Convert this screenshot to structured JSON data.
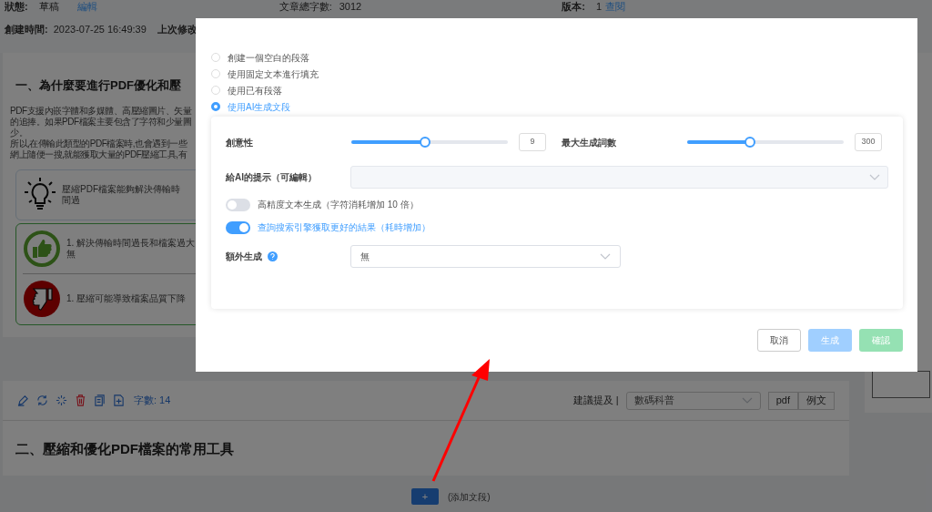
{
  "header": {
    "status_label": "狀態:",
    "status_value": "草稿",
    "edit_link": "編輯",
    "word_total_label": "文章總字數:",
    "word_total_value": "3012",
    "version_label": "版本:",
    "version_value": "1",
    "version_link": "查閱",
    "created_label": "創建時間:",
    "created_value": "2023-07-25 16:49:39",
    "modified_label": "上次修改"
  },
  "section_one": {
    "heading": "一、為什麼要進行PDF優化和壓",
    "paragraph_lines": [
      "PDF支援內嵌字體和多媒體、高壓縮圖片、矢量",
      "的追捧。如果PDF檔案主要包含了字符和少量圖",
      "少。",
      "所以,在傳輸此類型的PDF檔案時,也會遇到一些",
      "網上隨便一搜,就能獲取大量的PDF壓縮工具,有"
    ],
    "callout": "壓縮PDF檔案能夠解決傳輸時間過",
    "pros": [
      "1. 解決傳輸時間過長和檔案過大無"
    ],
    "cons": [
      "1. 壓縮可能導致檔案品質下降"
    ]
  },
  "section_two": {
    "word_count": "字數: 14",
    "suggest_label": "建議提及 |",
    "suggest_select": "數碼科普",
    "buttons": [
      "pdf",
      "例文"
    ],
    "heading": "二、壓縮和優化PDF檔案的常用工具"
  },
  "add_button": "+",
  "add_hint": "(添加文段)",
  "dialog": {
    "options": [
      {
        "label": "創建一個空白的段落",
        "selected": false
      },
      {
        "label": "使用固定文本進行填充",
        "selected": false
      },
      {
        "label": "使用已有段落",
        "selected": false
      },
      {
        "label": "使用AI生成文段",
        "selected": true
      }
    ],
    "sliders": [
      {
        "label": "創意性",
        "level": 0.47,
        "value": "9"
      },
      {
        "label": "最大生成詞數",
        "level": 0.4,
        "value": "300"
      }
    ],
    "prompt_label": "給AI的提示（可編輯）",
    "toggles": [
      {
        "label": "高精度文本生成（字符消耗增加 10 倍）",
        "on": false
      },
      {
        "label": "查詢搜索引擎獲取更好的結果（耗時增加）",
        "on": true
      }
    ],
    "extra_label": "額外生成",
    "extra_value": "無",
    "buttons": [
      {
        "label": "取消",
        "kind": "plain",
        "disabled": false
      },
      {
        "label": "生成",
        "kind": "primary",
        "disabled": true
      },
      {
        "label": "確認",
        "kind": "success",
        "disabled": true
      }
    ]
  }
}
